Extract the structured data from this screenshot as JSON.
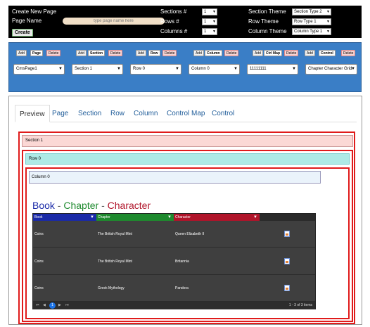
{
  "top": {
    "create_title": "Create New Page",
    "page_name_label": "Page Name",
    "page_name_placeholder": "type page name here",
    "create_button": "Create",
    "sections_label": "Sections #",
    "rows_label": "Rows #",
    "columns_label": "Columns #",
    "sections_value": "1",
    "rows_value": "1",
    "columns_value": "1",
    "section_theme_label": "Section Theme",
    "row_theme_label": "Row Theme",
    "column_theme_label": "Column Theme",
    "section_theme_value": "Section Type 2",
    "row_theme_value": "Row Type 1",
    "column_theme_value": "Column Type 1"
  },
  "toolbar": {
    "add": "Add",
    "delete": "Delete",
    "groups": [
      "Page",
      "Section",
      "Row",
      "Column",
      "Ctrl Map",
      "Control"
    ],
    "selects": [
      "CmsPage1",
      "Section 1",
      "Row 0",
      "Column 0",
      "11111111",
      "Chapter Character Grid"
    ]
  },
  "tabs": [
    "Preview",
    "Page",
    "Section",
    "Row",
    "Column",
    "Control Map",
    "Control"
  ],
  "layout": {
    "section_label": "Section 1",
    "row_label": "Row 0",
    "column_label": "Column 0"
  },
  "grid": {
    "title_book": "Book",
    "title_sep1": " - ",
    "title_chapter": "Chapter",
    "title_sep2": " - ",
    "title_character": "Character",
    "headers": [
      "Book",
      "Chapter",
      "Character"
    ],
    "header_colors": [
      "#1a2aa8",
      "#1e8a2e",
      "#b0142a"
    ],
    "rows": [
      [
        "Coins",
        "The British Royal Mint",
        "Queen Elizabeth II"
      ],
      [
        "Coins",
        "The British Royal Mint",
        "Britannia"
      ],
      [
        "Coins",
        "Greek Mythology",
        "Pandora"
      ]
    ],
    "pager_first": "⏮",
    "pager_prev": "◀",
    "pager_page": "1",
    "pager_next": "▶",
    "pager_last": "⏭",
    "pager_info": "1 - 3 of 3 items"
  }
}
